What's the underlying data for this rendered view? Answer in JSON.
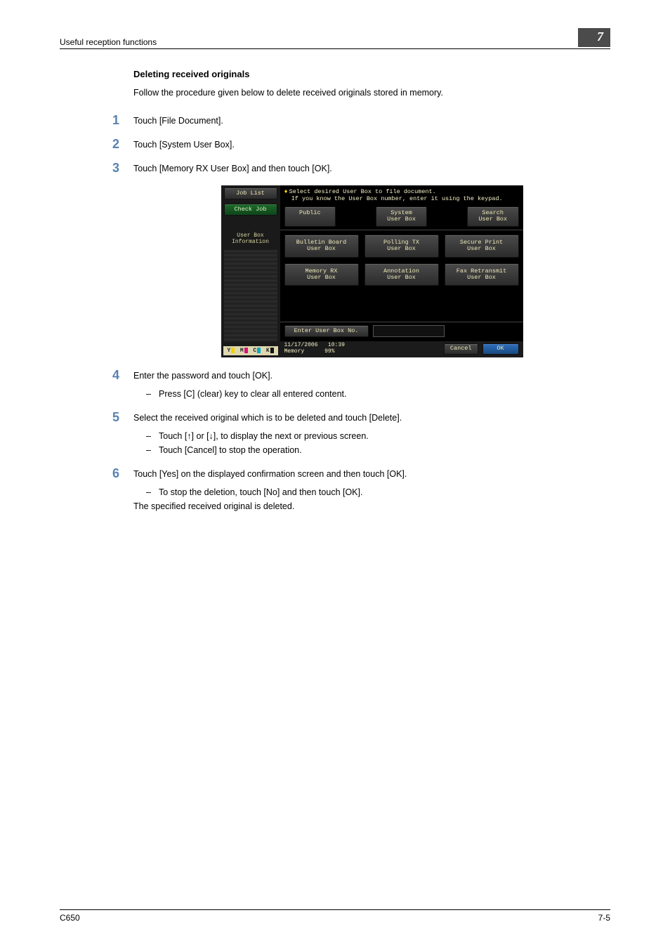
{
  "header": {
    "section": "Useful reception functions",
    "chapter": "7"
  },
  "title": "Deleting received originals",
  "intro": "Follow the procedure given below to delete received originals stored in memory.",
  "steps": {
    "s1": {
      "num": "1",
      "text": "Touch [File Document]."
    },
    "s2": {
      "num": "2",
      "text": "Touch [System User Box]."
    },
    "s3": {
      "num": "3",
      "text": "Touch [Memory RX User Box] and then touch [OK]."
    },
    "s4": {
      "num": "4",
      "text": "Enter the password and touch [OK].",
      "sub": [
        "Press [C] (clear) key to clear all entered content."
      ]
    },
    "s5": {
      "num": "5",
      "text": "Select the received original which is to be deleted and touch [Delete].",
      "sub": [
        "Touch [↑] or [↓], to display the next or previous screen.",
        "Touch [Cancel] to stop the operation."
      ]
    },
    "s6": {
      "num": "6",
      "text": "Touch [Yes] on the displayed confirmation screen and then touch [OK].",
      "sub": [
        "To stop the deletion, touch [No] and then touch [OK]."
      ],
      "after": "The specified received original is deleted."
    }
  },
  "device": {
    "left": {
      "job_list": "Job List",
      "check_job": "Check Job",
      "user_box_info": "User Box\nInformation",
      "toner": {
        "y": "Y",
        "m": "M",
        "c": "C",
        "k": "K"
      }
    },
    "instr_line1": "Select desired User Box to file document.",
    "instr_line2": "If you know the User Box number, enter it using the keypad.",
    "tabs": {
      "public": "Public",
      "system": "System\nUser Box",
      "search": "Search\nUser Box"
    },
    "boxes": {
      "bulletin": "Bulletin Board\nUser Box",
      "polling": "Polling TX\nUser Box",
      "secure": "Secure Print\nUser Box",
      "memory": "Memory RX\nUser Box",
      "annotation": "Annotation\nUser Box",
      "fax": "Fax Retransmit\nUser Box"
    },
    "enter_label": "Enter User Box No.",
    "status": {
      "date": "11/17/2006",
      "time": "10:39",
      "mem_label": "Memory",
      "mem_pct": "99%"
    },
    "actions": {
      "cancel": "Cancel",
      "ok": "OK"
    }
  },
  "footer": {
    "left": "C650",
    "right": "7-5"
  }
}
